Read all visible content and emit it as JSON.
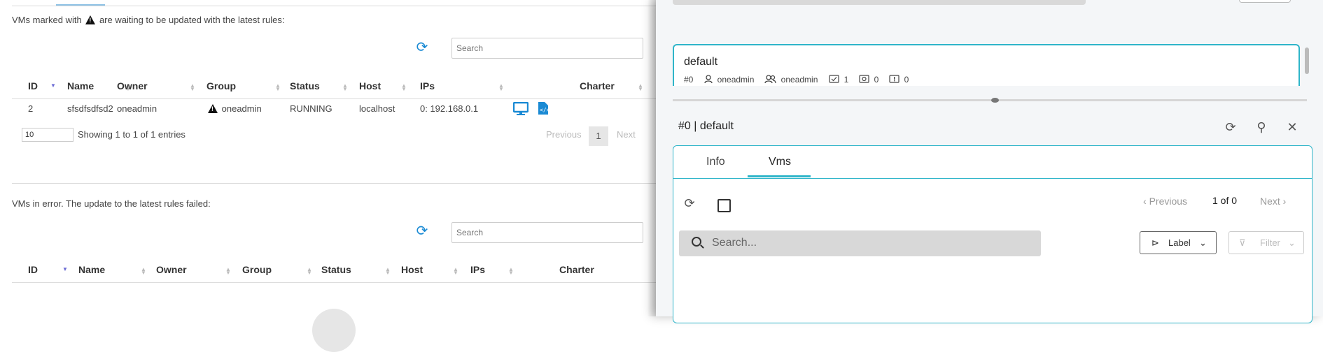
{
  "legacy": {
    "waiting_note_before": "VMs marked with",
    "waiting_note_after": "are waiting to be updated with the latest rules:",
    "error_note": "VMs in error. The update to the latest rules failed:",
    "search_placeholder": "Search",
    "columns1": [
      "ID",
      "Name",
      "Owner",
      "Group",
      "Status",
      "Host",
      "IPs",
      "Charter"
    ],
    "row": {
      "id": "2",
      "name": "sfsdfsdfsd2",
      "owner": "oneadmin",
      "group": "oneadmin",
      "status": "RUNNING",
      "host": "localhost",
      "ips": "0: 192.168.0.1"
    },
    "page_length": "10",
    "showing": "Showing 1 to 1 of 1 entries",
    "previous": "Previous",
    "page": "1",
    "next": "Next",
    "columns2": [
      "ID",
      "Name",
      "Owner",
      "Group",
      "Status",
      "Host",
      "IPs",
      "Charter"
    ]
  },
  "panel": {
    "card": {
      "name": "default",
      "id": "#0",
      "owner": "oneadmin",
      "group": "oneadmin",
      "count_vms": "1",
      "count_updated": "0",
      "count_error": "0"
    },
    "detail_title": "#0 | default",
    "tabs": [
      "Info",
      "Vms"
    ],
    "active_tab": "Vms",
    "prev_label": "Previous",
    "page_count": "1 of 0",
    "next_label": "Next",
    "search_placeholder": "Search...",
    "label_btn": "Label",
    "filter_btn": "Filter"
  },
  "colors": {
    "accent": "#2fb5c9",
    "legacy_blue": "#1a8ad4"
  }
}
